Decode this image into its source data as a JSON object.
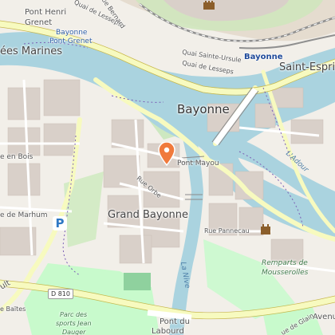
{
  "map": {
    "labels": {
      "city": "Bayonne",
      "district": "Grand Bayonne",
      "saint_esprit": "Saint-Espri",
      "allees_marines": "ées Marines",
      "pont_henri_grenet_1": "Pont Henri",
      "pont_henri_grenet_2": "Grenet",
      "station_pont_grenet_1": "Bayonne",
      "station_pont_grenet_2": "Pont Grenet",
      "station_bayonne": "Bayonne",
      "quai_lesseps_1": "Quai de Lesseps",
      "quai_lesseps_2": "Quai de Lesseps",
      "quai_sainte_ursule": "Quai Sainte-Ursule",
      "rue_bernard": "ue Bernard",
      "pont_mayou": "Pont Mayou",
      "rue_orbe": "Rue Orbe",
      "rue_pannecau": "Rue Pannecau",
      "ladour": "L'Adour",
      "la_nive": "La Nive",
      "en_bois": "e en Bois",
      "marhum": "e de Marhum",
      "remparts_1": "Remparts de",
      "remparts_2": "Mousserolles",
      "parc_sports_1": "Parc des",
      "parc_sports_2": "sports Jean",
      "parc_sports_3": "Dauger",
      "pont_labourd_1": "Pont du",
      "pont_labourd_2": "Labourd",
      "avenue": "Avenu",
      "rue_gl": "ue de Glain",
      "baites": "e Baïtes",
      "ult": "ult",
      "road_shield": "D 810",
      "parking": "P"
    },
    "icons": {
      "pin": "map-pin-icon",
      "parking": "parking-icon",
      "castle": "castle-icon"
    },
    "colors": {
      "water": "#aad3df",
      "land": "#f2efe9",
      "park": "#c8facc",
      "building": "#d9d0c9",
      "road_major": "#f7fabf",
      "rail": "#8f8f8f",
      "pin": "#f07a3c"
    }
  }
}
